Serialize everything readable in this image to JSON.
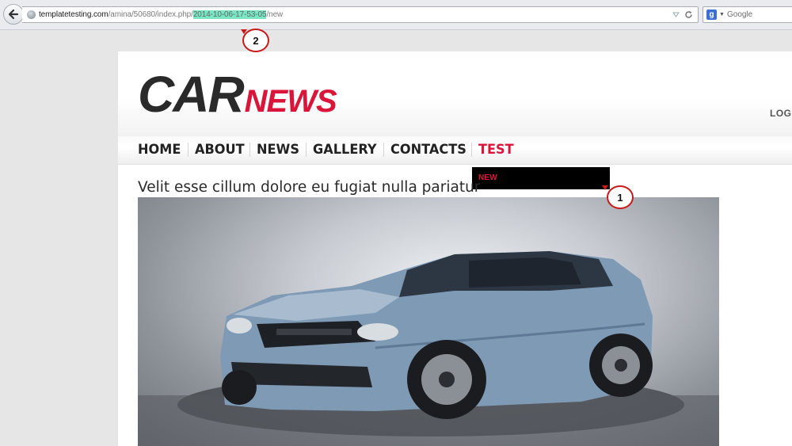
{
  "browser": {
    "url": {
      "host": "templatetesting.com",
      "path_before": "/amina/50680/index.php/",
      "highlighted": "2014-10-06-17-53-05",
      "path_after": "/new"
    },
    "search_placeholder": "Google",
    "search_engine_letter": "g"
  },
  "site": {
    "logo": {
      "car": "CAR",
      "news": "NEWS"
    },
    "login_label": "LOGI",
    "nav": [
      {
        "label": "HOME"
      },
      {
        "label": "ABOUT"
      },
      {
        "label": "NEWS"
      },
      {
        "label": "GALLERY"
      },
      {
        "label": "CONTACTS"
      },
      {
        "label": "TEST"
      }
    ],
    "dropdown": {
      "item": "NEW"
    },
    "article_title": "Velit esse cillum dolore eu fugiat nulla pariatur"
  },
  "annotations": [
    {
      "number": "1"
    },
    {
      "number": "2"
    }
  ],
  "colors": {
    "brand_red": "#d9163a",
    "text_dark": "#222222",
    "url_highlight": "#7be5c4",
    "car_body": "#7f9ab5",
    "annotation_border": "#c81a1a"
  },
  "icons": {
    "back": "back-arrow-icon",
    "site_identity": "globe-icon",
    "bookmark": "bookmark-arrow-icon",
    "reload": "reload-icon",
    "search_engine": "google-icon"
  }
}
